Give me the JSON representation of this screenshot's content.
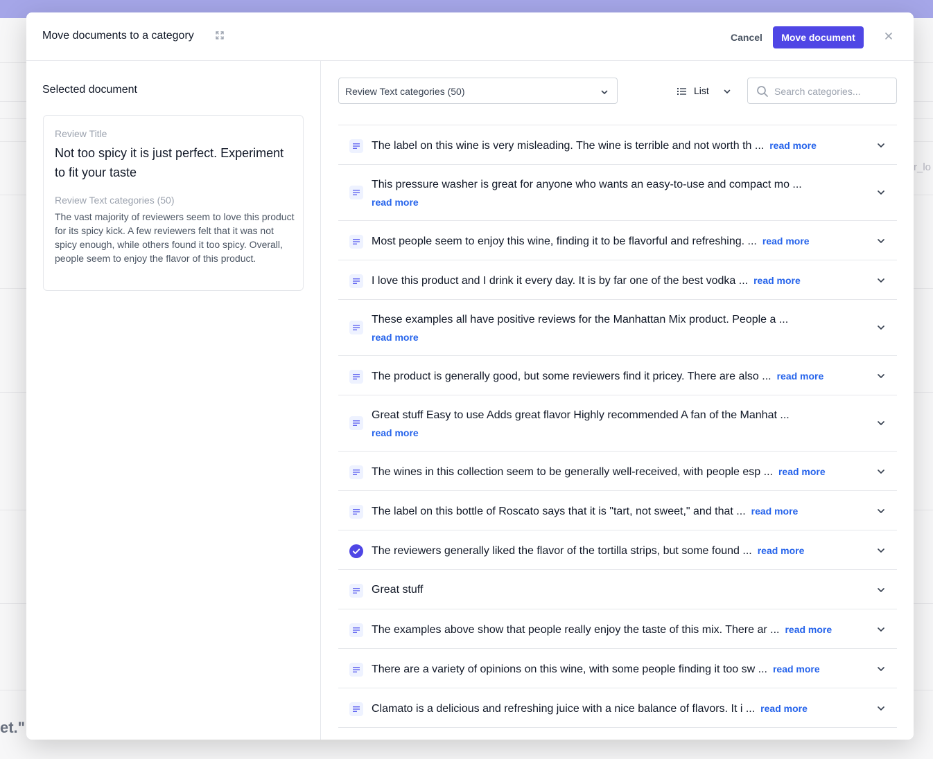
{
  "modal": {
    "title": "Move documents to a category",
    "cancel_label": "Cancel",
    "move_label": "Move document"
  },
  "left": {
    "section_title": "Selected document",
    "card": {
      "title_label": "Review Title",
      "title": "Not too spicy it is just perfect. Experiment to fit your taste",
      "category_label": "Review Text categories (50)",
      "body": "The vast majority of reviewers seem to love this product for its spicy kick. A few reviewers felt that it was not spicy enough, while others found it too spicy. Overall, people seem to enjoy the flavor of this product."
    }
  },
  "right": {
    "category_select": "Review Text categories (50)",
    "view_label": "List",
    "search_placeholder": "Search categories...",
    "read_more": "read more",
    "items": [
      {
        "text": "The label on this wine is very misleading. The wine is terrible and not worth th ...",
        "read_more": true,
        "tall": false,
        "selected": false
      },
      {
        "text": "This pressure washer is great for anyone who wants an easy-to-use and compact mo ...",
        "read_more": true,
        "tall": true,
        "selected": false
      },
      {
        "text": "Most people seem to enjoy this wine, finding it to be flavorful and refreshing. ...",
        "read_more": true,
        "tall": false,
        "selected": false
      },
      {
        "text": "I love this product and I drink it every day. It is by far one of the best vodka ...",
        "read_more": true,
        "tall": false,
        "selected": false
      },
      {
        "text": "These examples all have positive reviews for the Manhattan Mix product. People a ...",
        "read_more": true,
        "tall": true,
        "selected": false
      },
      {
        "text": "The product is generally good, but some reviewers find it pricey. There are also ...",
        "read_more": true,
        "tall": false,
        "selected": false
      },
      {
        "text": "Great stuff Easy to use Adds great flavor Highly recommended A fan of the Manhat ...",
        "read_more": true,
        "tall": true,
        "selected": false
      },
      {
        "text": "The wines in this collection seem to be generally well-received, with people esp ...",
        "read_more": true,
        "tall": false,
        "selected": false
      },
      {
        "text": "The label on this bottle of Roscato says that it is \"tart, not sweet,\" and that ...",
        "read_more": true,
        "tall": false,
        "selected": false
      },
      {
        "text": "The reviewers generally liked the flavor of the tortilla strips, but some found ...",
        "read_more": true,
        "tall": false,
        "selected": true
      },
      {
        "text": "Great stuff",
        "read_more": false,
        "tall": false,
        "selected": false
      },
      {
        "text": "The examples above show that people really enjoy the taste of this mix. There ar ...",
        "read_more": true,
        "tall": false,
        "selected": false
      },
      {
        "text": "There are a variety of opinions on this wine, with some people finding it too sw ...",
        "read_more": true,
        "tall": false,
        "selected": false
      },
      {
        "text": "Clamato is a delicious and refreshing juice with a nice balance of flavors. It i ...",
        "read_more": true,
        "tall": false,
        "selected": false
      }
    ]
  },
  "background": {
    "right_fragment": "r_lo",
    "left_fragment": "et.\""
  },
  "colors": {
    "accent": "#4f46e5",
    "link": "#2563eb",
    "topbar": "#a5a6e8"
  }
}
